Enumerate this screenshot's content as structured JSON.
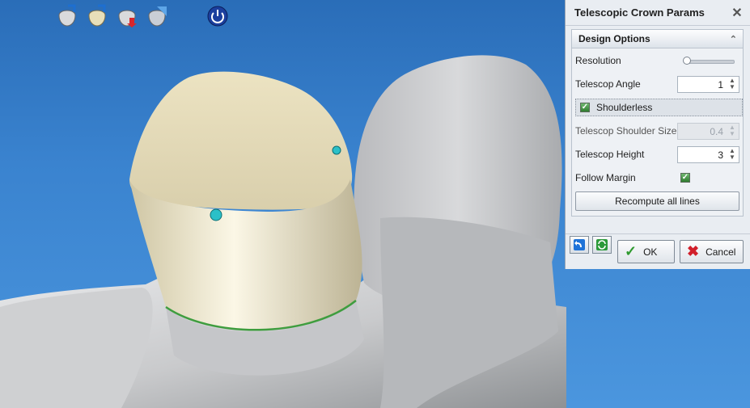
{
  "toolbar": {
    "icons": [
      "tooth-scan-export-icon",
      "tooth-crown-export-icon",
      "tooth-download-icon",
      "tooth-gradient-icon",
      "power-icon"
    ]
  },
  "dialog": {
    "title": "Telescopic Crown Params",
    "close_symbol": "✕",
    "group_title": "Design Options",
    "collapse_symbol": "⌃",
    "resolution": {
      "label": "Resolution",
      "level": 0
    },
    "telescop_angle": {
      "label": "Telescop Angle",
      "value": "1"
    },
    "shoulderless": {
      "label": "Shoulderless",
      "checked": true
    },
    "shoulder_size": {
      "label": "Telescop Shoulder Size",
      "value": "0.4",
      "disabled": true
    },
    "telescop_height": {
      "label": "Telescop Height",
      "value": "3"
    },
    "follow_margin": {
      "label": "Follow Margin",
      "checked": true
    },
    "recompute_label": "Recompute all lines",
    "ok_label": "OK",
    "cancel_label": "Cancel"
  },
  "colors": {
    "background": "#3a83cf",
    "crown": "#e9e2c4",
    "tissue": "#c8c9cb",
    "margin_line": "#3f9d3f",
    "control_point": "#2bc0c8"
  }
}
